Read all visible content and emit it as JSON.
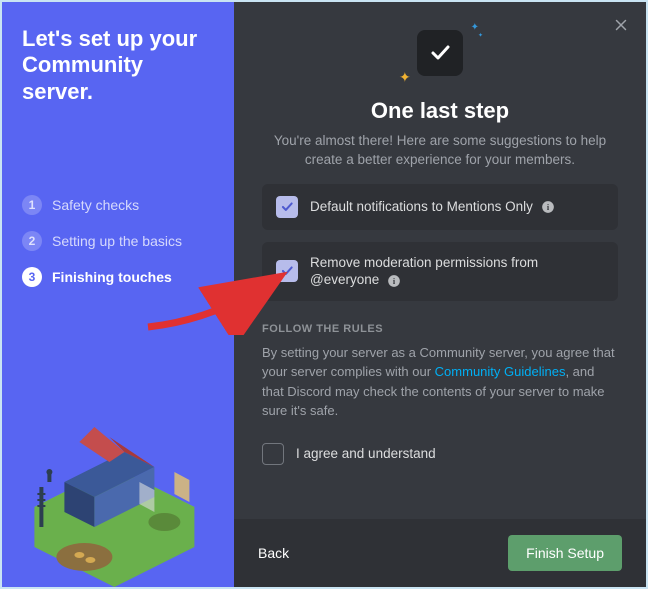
{
  "sidebar": {
    "title": "Let's set up your Community server.",
    "steps": [
      {
        "num": "1",
        "label": "Safety checks",
        "active": false
      },
      {
        "num": "2",
        "label": "Setting up the basics",
        "active": false
      },
      {
        "num": "3",
        "label": "Finishing touches",
        "active": true
      }
    ]
  },
  "main": {
    "title": "One last step",
    "subtitle": "You're almost there! Here are some suggestions to help create a better experience for your members.",
    "option1": "Default notifications to Mentions Only",
    "option2_pre": "Remove moderation permissions from ",
    "option2_tag": "@everyone",
    "rules_heading": "FOLLOW THE RULES",
    "rules_text_a": "By setting your server as a Community server, you agree that your server complies with our ",
    "rules_link": "Community Guidelines",
    "rules_text_b": ", and that Discord may check the contents of your server to make sure it's safe.",
    "agree_label": "I agree and understand"
  },
  "footer": {
    "back": "Back",
    "finish": "Finish Setup"
  },
  "colors": {
    "brand": "#5865f2",
    "dark_bg": "#36393f",
    "card_bg": "#2f3136",
    "cta": "#5d9e6c",
    "link": "#00aff4"
  }
}
